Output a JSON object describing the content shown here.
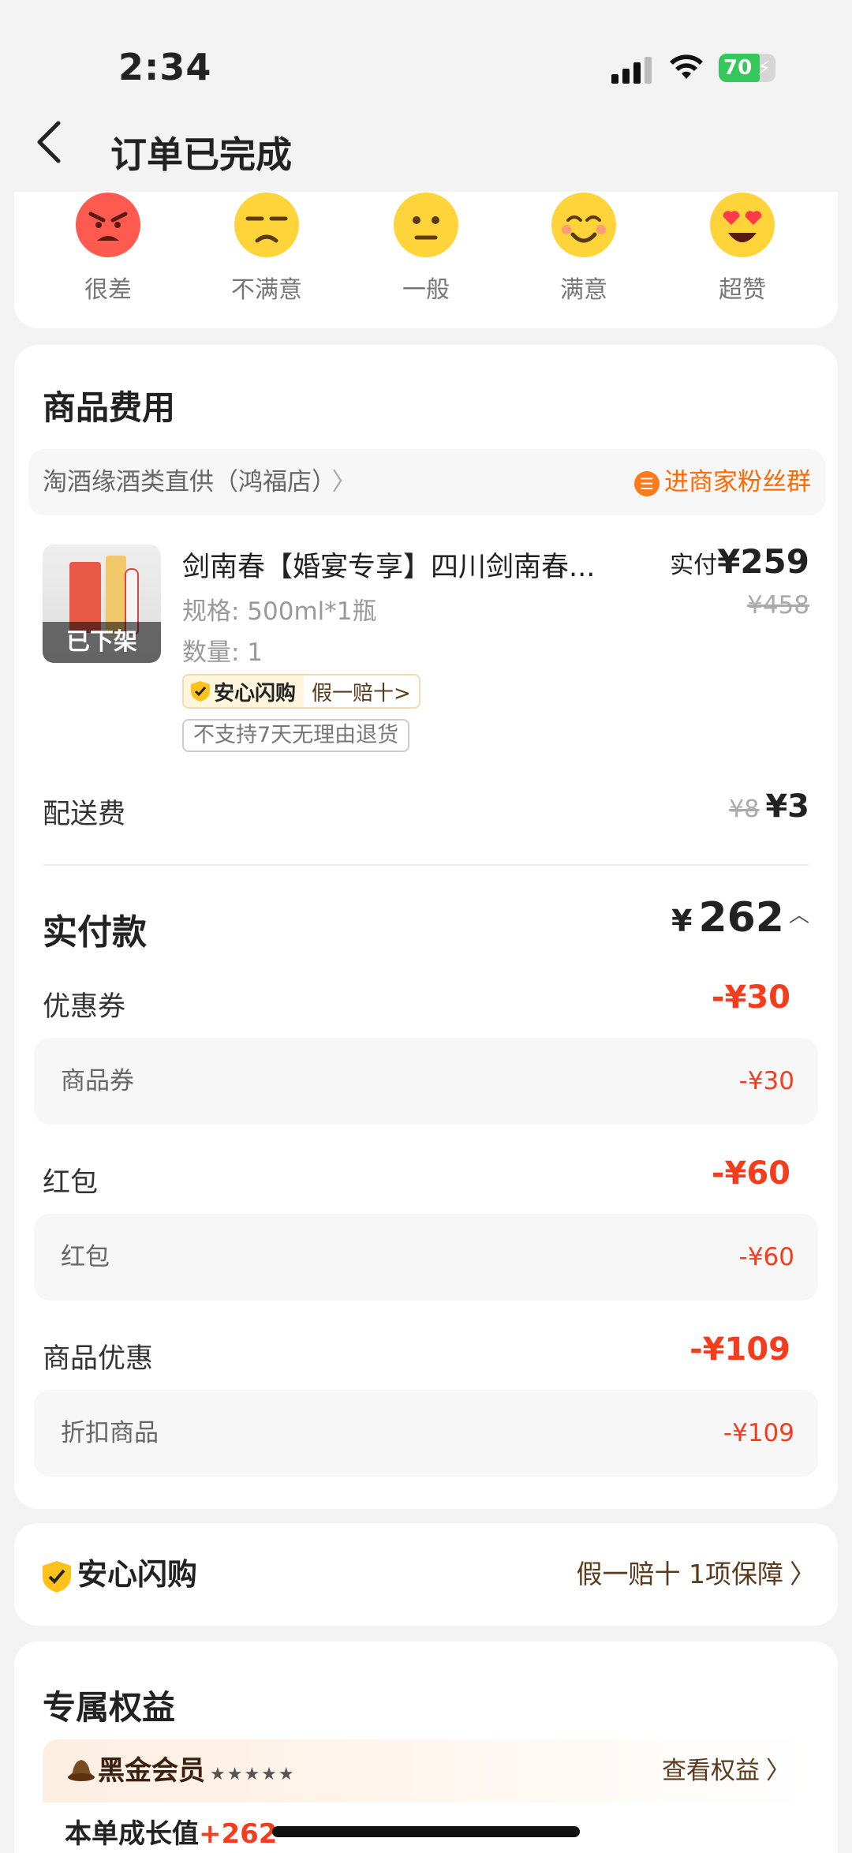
{
  "status_bar": {
    "time": "2:34",
    "battery": "70"
  },
  "nav": {
    "title": "订单已完成"
  },
  "rating": {
    "options": [
      {
        "label": "很差",
        "icon": "angry-face-icon",
        "color": "#ff5a4f"
      },
      {
        "label": "不满意",
        "icon": "unamused-face-icon",
        "color": "#ffd43b"
      },
      {
        "label": "一般",
        "icon": "neutral-face-icon",
        "color": "#ffd43b"
      },
      {
        "label": "满意",
        "icon": "smiling-face-icon",
        "color": "#ffd43b"
      },
      {
        "label": "超赞",
        "icon": "heart-eyes-face-icon",
        "color": "#ffd43b"
      }
    ]
  },
  "fees": {
    "title": "商品费用",
    "shop_name": "淘酒缘酒类直供（鸿福店）",
    "shop_fans": "进商家粉丝群",
    "product": {
      "title": "剑南春【婚宴专享】四川剑南春...",
      "spec": "规格: 500ml*1瓶",
      "qty": "数量: 1",
      "status": "已下架",
      "paid_label": "实付",
      "paid_price": "¥259",
      "orig_price": "¥458",
      "tag_anxin": "安心闪购",
      "tag_guarantee": "假一赔十>",
      "tag_noreturn": "不支持7天无理由退货"
    },
    "shipping": {
      "label": "配送费",
      "orig": "¥8",
      "price": "¥3"
    },
    "total": {
      "label": "实付款",
      "currency": "¥",
      "value": "262"
    },
    "discounts": [
      {
        "label": "优惠券",
        "value": "-¥30",
        "sub_label": "商品券",
        "sub_value": "-¥30"
      },
      {
        "label": "红包",
        "value": "-¥60",
        "sub_label": "红包",
        "sub_value": "-¥60"
      },
      {
        "label": "商品优惠",
        "value": "-¥109",
        "sub_label": "折扣商品",
        "sub_value": "-¥109"
      }
    ]
  },
  "anxin": {
    "title": "安心闪购",
    "link": "假一赔十 1项保障"
  },
  "benefits": {
    "title": "专属权益",
    "vip_name": "黑金会员",
    "vip_stars": "★★★★★",
    "vip_link": "查看权益",
    "growth_label": "本单成长值",
    "growth_value": "+262"
  },
  "colors": {
    "accent_red": "#f33d1d",
    "accent_orange": "#ff6a00",
    "brown": "#5a3a1a"
  }
}
